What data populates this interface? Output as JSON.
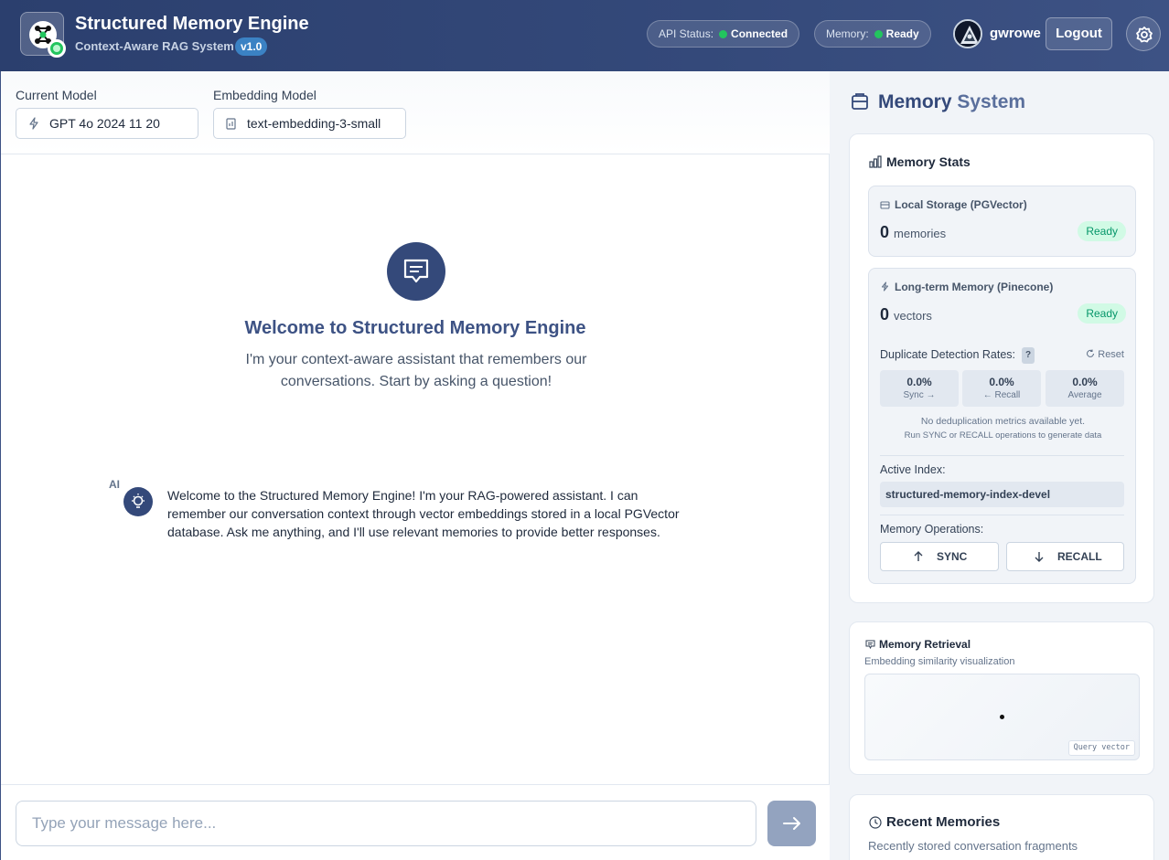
{
  "header": {
    "title": "Structured Memory Engine",
    "subtitle": "Context-Aware RAG System",
    "version": "v1.0",
    "api_status_label": "API Status:",
    "api_status_value": "Connected",
    "memory_label": "Memory:",
    "memory_value": "Ready",
    "username": "gwrowe",
    "logout_label": "Logout",
    "status_color": "#22c55e"
  },
  "models": {
    "current_label": "Current Model",
    "current_value": "GPT 4o 2024 11 20",
    "embedding_label": "Embedding Model",
    "embedding_value": "text-embedding-3-small"
  },
  "chat": {
    "welcome_title": "Welcome to Structured Memory Engine",
    "welcome_text": "I'm your context-aware assistant that remembers our conversations. Start by asking a question!",
    "ai_label": "AI",
    "ai_message": "Welcome to the Structured Memory Engine! I'm your RAG-powered assistant. I can remember our conversation context through vector embeddings stored in a local PGVector database. Ask me anything, and I'll use relevant memories to provide better responses.",
    "input_placeholder": "Type your message here..."
  },
  "memory": {
    "title_a": "Memory",
    "title_b": "System",
    "stats_title": "Memory Stats",
    "local": {
      "title": "Local Storage (PGVector)",
      "count": "0",
      "unit": "memories",
      "status": "Ready"
    },
    "longterm": {
      "title": "Long-term Memory (Pinecone)",
      "count": "0",
      "unit": "vectors",
      "status": "Ready"
    },
    "dedup": {
      "label": "Duplicate Detection Rates:",
      "help": "?",
      "reset": "Reset",
      "metrics": [
        {
          "value": "0.0%",
          "label": "Sync →"
        },
        {
          "value": "0.0%",
          "label": "← Recall"
        },
        {
          "value": "0.0%",
          "label": "Average"
        }
      ],
      "empty_line1": "No deduplication metrics available yet.",
      "empty_line2": "Run SYNC or RECALL operations to generate data"
    },
    "active_index_label": "Active Index:",
    "active_index_value": "structured-memory-index-devel",
    "ops_label": "Memory Operations:",
    "sync_label": "SYNC",
    "recall_label": "RECALL"
  },
  "retrieval": {
    "title": "Memory Retrieval",
    "subtitle": "Embedding similarity visualization",
    "query_label": "Query vector"
  },
  "recent": {
    "title": "Recent Memories",
    "subtitle": "Recently stored conversation fragments"
  }
}
